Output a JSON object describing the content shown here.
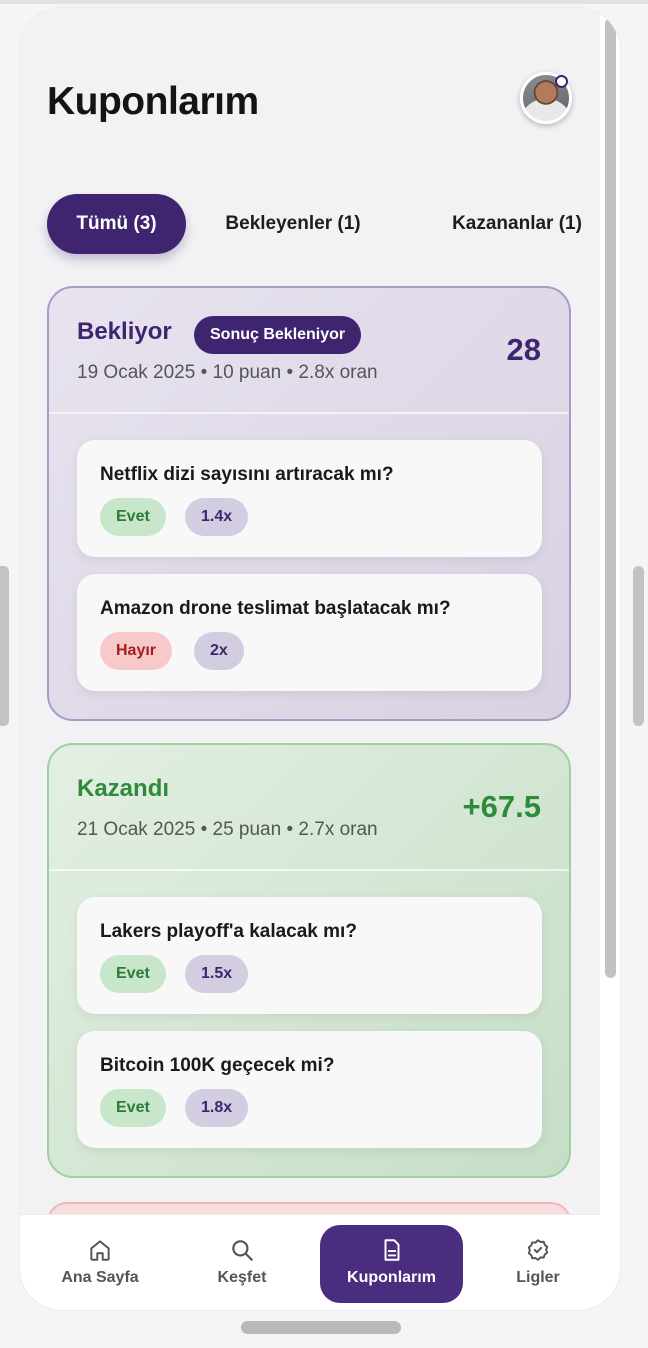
{
  "page": {
    "title": "Kuponlarım"
  },
  "tabs": [
    {
      "label": "Tümü (3)",
      "active": true
    },
    {
      "label": "Bekleyenler (1)",
      "active": false
    },
    {
      "label": "Kazananlar (1)",
      "active": false
    }
  ],
  "coupons": [
    {
      "status": "Bekliyor",
      "badge": "Sonuç Bekleniyor",
      "meta": "19 Ocak 2025 • 10 puan • 2.8x oran",
      "amount": "28",
      "picks": [
        {
          "question": "Netflix dizi sayısını artıracak mı?",
          "answer": "Evet",
          "odds": "1.4x"
        },
        {
          "question": "Amazon drone teslimat başlatacak mı?",
          "answer": "Hayır",
          "odds": "2x"
        }
      ]
    },
    {
      "status": "Kazandı",
      "meta": "21 Ocak 2025 • 25 puan • 2.7x oran",
      "amount": "+67.5",
      "picks": [
        {
          "question": "Lakers playoff'a kalacak mı?",
          "answer": "Evet",
          "odds": "1.5x"
        },
        {
          "question": "Bitcoin 100K geçecek mi?",
          "answer": "Evet",
          "odds": "1.8x"
        }
      ]
    }
  ],
  "nav": [
    {
      "label": "Ana Sayfa",
      "icon": "home-icon"
    },
    {
      "label": "Keşfet",
      "icon": "search-icon"
    },
    {
      "label": "Kuponlarım",
      "icon": "document-icon",
      "active": true
    },
    {
      "label": "Ligler",
      "icon": "badge-check-icon"
    }
  ],
  "colors": {
    "primary": "#3f2570",
    "success": "#2f8a3a",
    "danger": "#a3201f"
  }
}
